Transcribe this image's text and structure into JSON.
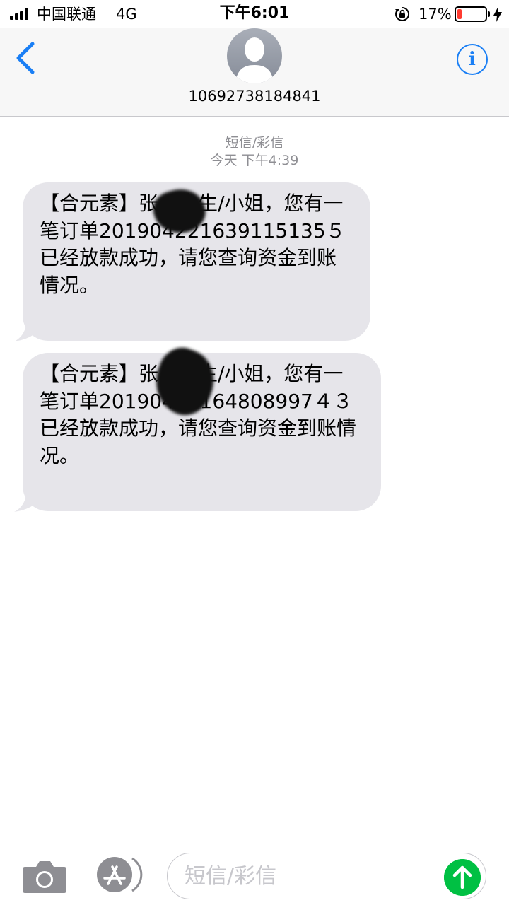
{
  "status_bar": {
    "carrier": "中国联通",
    "network": "4G",
    "time": "下午6:01",
    "battery_percent": "17%",
    "battery_level": 0.17,
    "signal_bars_filled": 4
  },
  "header": {
    "contact": "10692738184841",
    "back_icon": "chevron-left-icon",
    "info_icon": "info-icon",
    "info_glyph": "i"
  },
  "conversation": {
    "label": "短信/彩信",
    "timestamp": "今天 下午4:39"
  },
  "messages": [
    {
      "text": "【合元素】张…先生/小姐，您有一笔订单201904221639115135５已经放款成功，请您查询资金到账情况。"
    },
    {
      "text": "【合元素】张…先生/小姐，您有一笔订单20190422164808997４３已经放款成功，请您查询资金到账情况。"
    }
  ],
  "input": {
    "placeholder": "短信/彩信",
    "camera_icon": "camera-icon",
    "apps_icon": "app-store-icon",
    "send_icon": "send-arrow-icon"
  },
  "colors": {
    "accent": "#1a7ff5",
    "bubble": "#e6e5ea",
    "send": "#00c043",
    "battery_low": "#ff3b30",
    "meta_text": "#8e8e93"
  }
}
